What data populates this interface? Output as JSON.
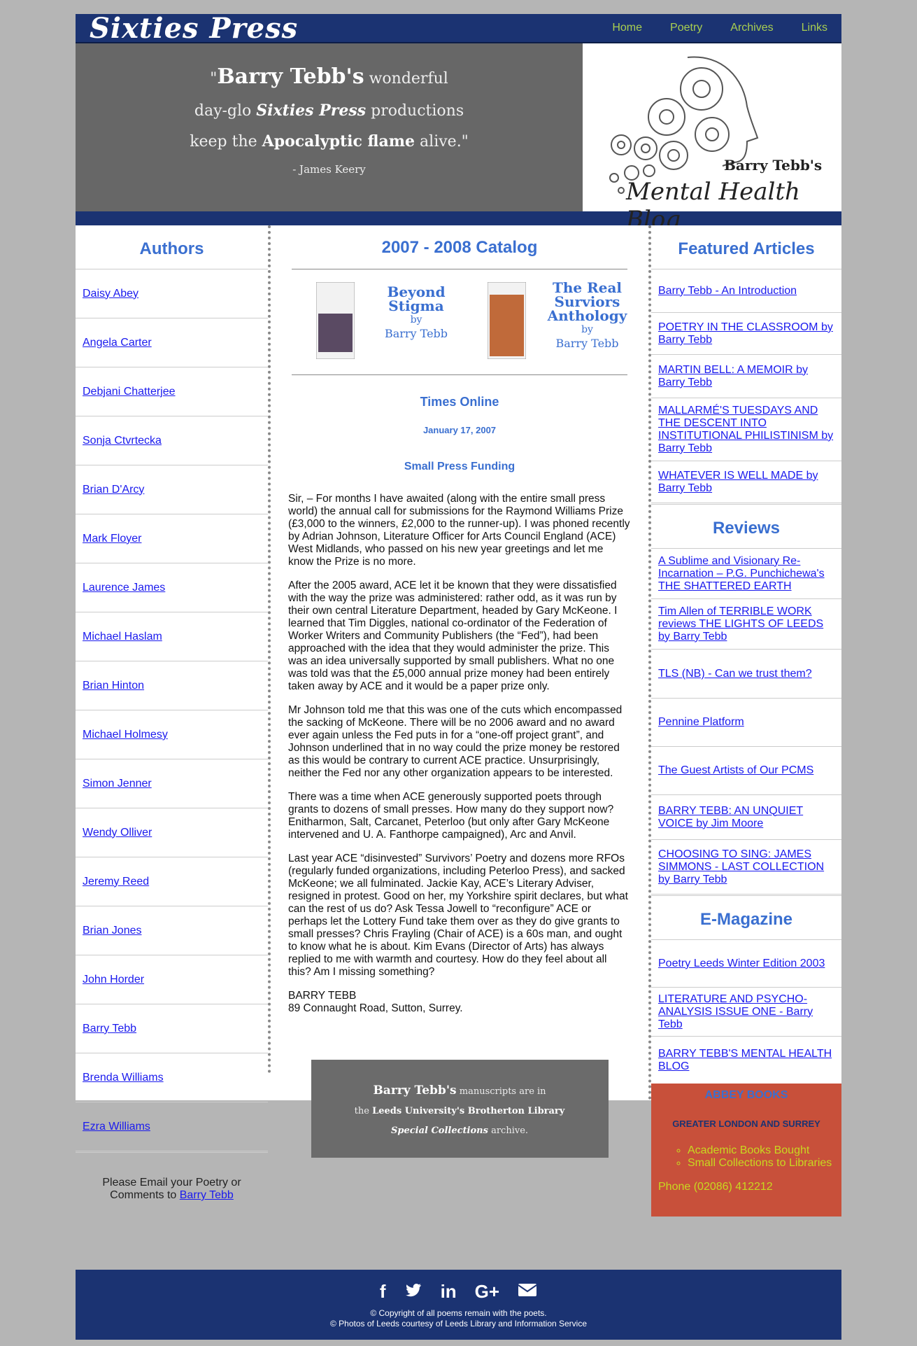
{
  "site": {
    "logo": "Sixties Press"
  },
  "nav": [
    "Home",
    "Poetry",
    "Archives",
    "Links"
  ],
  "hero": {
    "open_quote": "\"",
    "name": "Barry Tebb's",
    "l1_rest": " wonderful",
    "l2_pre": "day-glo ",
    "l2_brand": "Sixties Press",
    "l2_post": " productions",
    "l3_pre": "keep the ",
    "l3_bold": "Apocalyptic flame",
    "l3_post": "  alive.\"",
    "attribution": "- James Keery"
  },
  "blog": {
    "author": "Barry Tebb's",
    "title": "Mental Health Blog"
  },
  "authors": {
    "heading": "Authors",
    "items": [
      "Daisy Abey",
      "Angela Carter",
      "Debjani Chatterjee",
      "Sonja Ctvrtecka",
      "Brian D'Arcy",
      "Mark Floyer",
      "Laurence James",
      "Michael Haslam",
      "Brian Hinton",
      "Michael Holmesy",
      "Simon Jenner",
      "Wendy Olliver",
      "Jeremy Reed",
      "Brian Jones",
      "John Horder",
      "Barry Tebb",
      "Brenda Williams",
      "Ezra Williams"
    ],
    "email_text": "Please Email your Poetry or Comments to ",
    "email_link": "Barry Tebb"
  },
  "catalog": {
    "title": "2007 - 2008 Catalog",
    "book1": {
      "l1": "Beyond",
      "l2": "Stigma",
      "by": "by",
      "who": "Barry Tebb"
    },
    "book2": {
      "l1": "The Real",
      "l2": "Surviors",
      "l3": "Anthology",
      "by": "by",
      "who": "Barry Tebb"
    }
  },
  "article": {
    "source": "Times Online",
    "date": "January 17, 2007",
    "title": "Small Press Funding",
    "paragraphs": [
      "Sir, – For months I have awaited (along with the entire small press world) the annual call for submissions for the Raymond Williams Prize (£3,000 to the winners, £2,000 to the runner-up). I was phoned recently by Adrian Johnson, Literature Officer for Arts Council England (ACE) West Midlands, who passed on his new year greetings and let me know the Prize is no more.",
      "After the 2005 award, ACE let it be known that they were dissatisfied with the way the prize was administered: rather odd, as it was run by their own central Literature Department, headed by Gary McKeone. I learned that Tim Diggles, national co-ordinator of the Federation of Worker Writers and Community Publishers (the “Fed”), had been approached with the idea that they would administer the prize. This was an idea universally supported by small publishers. What no one was told was that the £5,000 annual prize money had been entirely taken away by ACE and it would be a paper prize only.",
      "Mr Johnson told me that this was one of the cuts which encompassed the sacking of McKeone. There will be no 2006 award and no award ever again unless the Fed puts in for a “one-off project grant”, and Johnson underlined that in no way could the prize money be restored as this would be contrary to current ACE practice. Unsurprisingly, neither the Fed nor any other organization appears to be interested.",
      "There was a time when ACE generously supported poets through grants to dozens of small presses. How many do they support now? Enitharmon, Salt, Carcanet, Peterloo (but only after Gary McKeone intervened and U. A. Fanthorpe campaigned), Arc and Anvil.",
      "Last year ACE “disinvested” Survivors’ Poetry and dozens more RFOs (regularly funded organizations, including Peterloo Press), and sacked McKeone; we all fulminated. Jackie Kay, ACE’s Literary Adviser, resigned in protest. Good on her, my Yorkshire spirit declares, but what can the rest of us do? Ask Tessa Jowell to “reconfigure” ACE or perhaps let the Lottery Fund take them over as they do give grants to small presses? Chris Frayling (Chair of ACE) is a 60s man, and ought to know what he is about. Kim Evans (Director of Arts) has always replied to me with warmth and courtesy. How do they feel about all this? Am I missing something?"
    ],
    "signature": "BARRY TEBB",
    "address": "89 Connaught Road, Sutton, Surrey."
  },
  "manuscripts": {
    "name": "Barry Tebb's",
    "l1_rest": " manuscripts are in",
    "l2_pre": "the ",
    "l2_bold": "Leeds University's Brotherton Library",
    "l3_bold": "Special Collections",
    "l3_rest": " archive."
  },
  "featured": {
    "heading": "Featured Articles",
    "items": [
      "Barry Tebb - An Introduction",
      "POETRY IN THE CLASSROOM by Barry Tebb",
      "MARTIN BELL: A MEMOIR by Barry Tebb",
      "MALLARMÉ'S TUESDAYS AND THE DESCENT INTO INSTITUTIONAL PHILISTINISM by Barry Tebb",
      "WHATEVER IS WELL MADE by Barry Tebb"
    ]
  },
  "reviews": {
    "heading": "Reviews",
    "items": [
      "A Sublime and Visionary Re-Incarnation – P.G. Punchichewa's THE SHATTERED EARTH",
      "Tim Allen of TERRIBLE WORK reviews THE LIGHTS OF LEEDS by Barry Tebb",
      "TLS (NB) - Can we trust them?",
      "Pennine Platform",
      "The Guest Artists of Our PCMS",
      "BARRY TEBB: AN UNQUIET VOICE by Jim Moore",
      "CHOOSING TO SING: JAMES SIMMONS - LAST COLLECTION by Barry Tebb"
    ]
  },
  "emagazine": {
    "heading": "E-Magazine",
    "items": [
      "Poetry Leeds Winter Edition 2003",
      "LITERATURE AND PSYCHO-ANALYSIS ISSUE ONE - Barry Tebb",
      "BARRY TEBB'S MENTAL HEALTH BLOG"
    ]
  },
  "abbey": {
    "title": "ABBEY BOOKS",
    "subtitle": "GREATER LONDON AND SURREY",
    "items": [
      "Academic Books Bought",
      "Small Collections to Libraries"
    ],
    "phone": "Phone (02086) 412212"
  },
  "footer": {
    "icons": [
      "facebook-icon",
      "twitter-icon",
      "linkedin-icon",
      "google-plus-icon",
      "email-icon"
    ],
    "line1": "© Copyright of all poems remain with the poets.",
    "line2": "© Photos of Leeds courtesy of Leeds Library and Information Service"
  },
  "colors": {
    "navy": "#1b3372",
    "nav_green": "#a9cf50",
    "heading_blue": "#3a6fd0",
    "abbey_red": "#c8503a"
  }
}
